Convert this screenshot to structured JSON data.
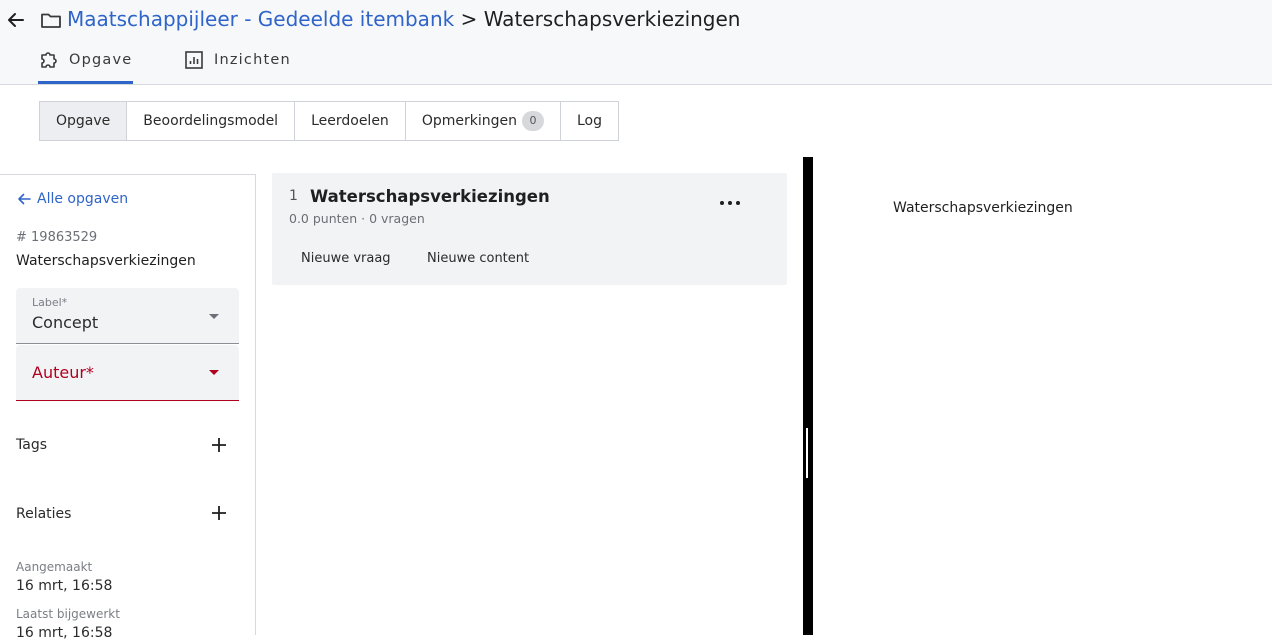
{
  "header": {
    "breadcrumb_link": "Maatschappijleer - Gedeelde itembank",
    "breadcrumb_sep": ">",
    "breadcrumb_current": "Waterschapsverkiezingen"
  },
  "main_tabs": [
    {
      "label": "Opgave",
      "icon": "puzzle-icon",
      "active": true
    },
    {
      "label": "Inzichten",
      "icon": "chart-icon",
      "active": false
    }
  ],
  "sub_tabs": [
    {
      "label": "Opgave",
      "active": true
    },
    {
      "label": "Beoordelingsmodel",
      "active": false
    },
    {
      "label": "Leerdoelen",
      "active": false
    },
    {
      "label": "Opmerkingen",
      "badge": "0",
      "active": false
    },
    {
      "label": "Log",
      "active": false
    }
  ],
  "sidebar": {
    "back_link": "Alle opgaven",
    "item_id": "# 19863529",
    "item_title": "Waterschapsverkiezingen",
    "label_field": {
      "label": "Label*",
      "value": "Concept"
    },
    "author_field": {
      "label": "Auteur*",
      "value": ""
    },
    "tags_label": "Tags",
    "relations_label": "Relaties",
    "created_key": "Aangemaakt",
    "created_value": "16 mrt, 16:58",
    "updated_key": "Laatst bijgewerkt",
    "updated_value": "16 mrt, 16:58"
  },
  "card": {
    "number": "1",
    "title": "Waterschapsverkiezingen",
    "subtitle": "0.0 punten · 0 vragen",
    "new_question": "Nieuwe vraag",
    "new_content": "Nieuwe content"
  },
  "preview": {
    "title": "Waterschapsverkiezingen"
  },
  "colors": {
    "accent": "#2f64c8",
    "error": "#b00020",
    "header_bg": "#f7f8fa",
    "card_bg": "#f2f3f5"
  }
}
